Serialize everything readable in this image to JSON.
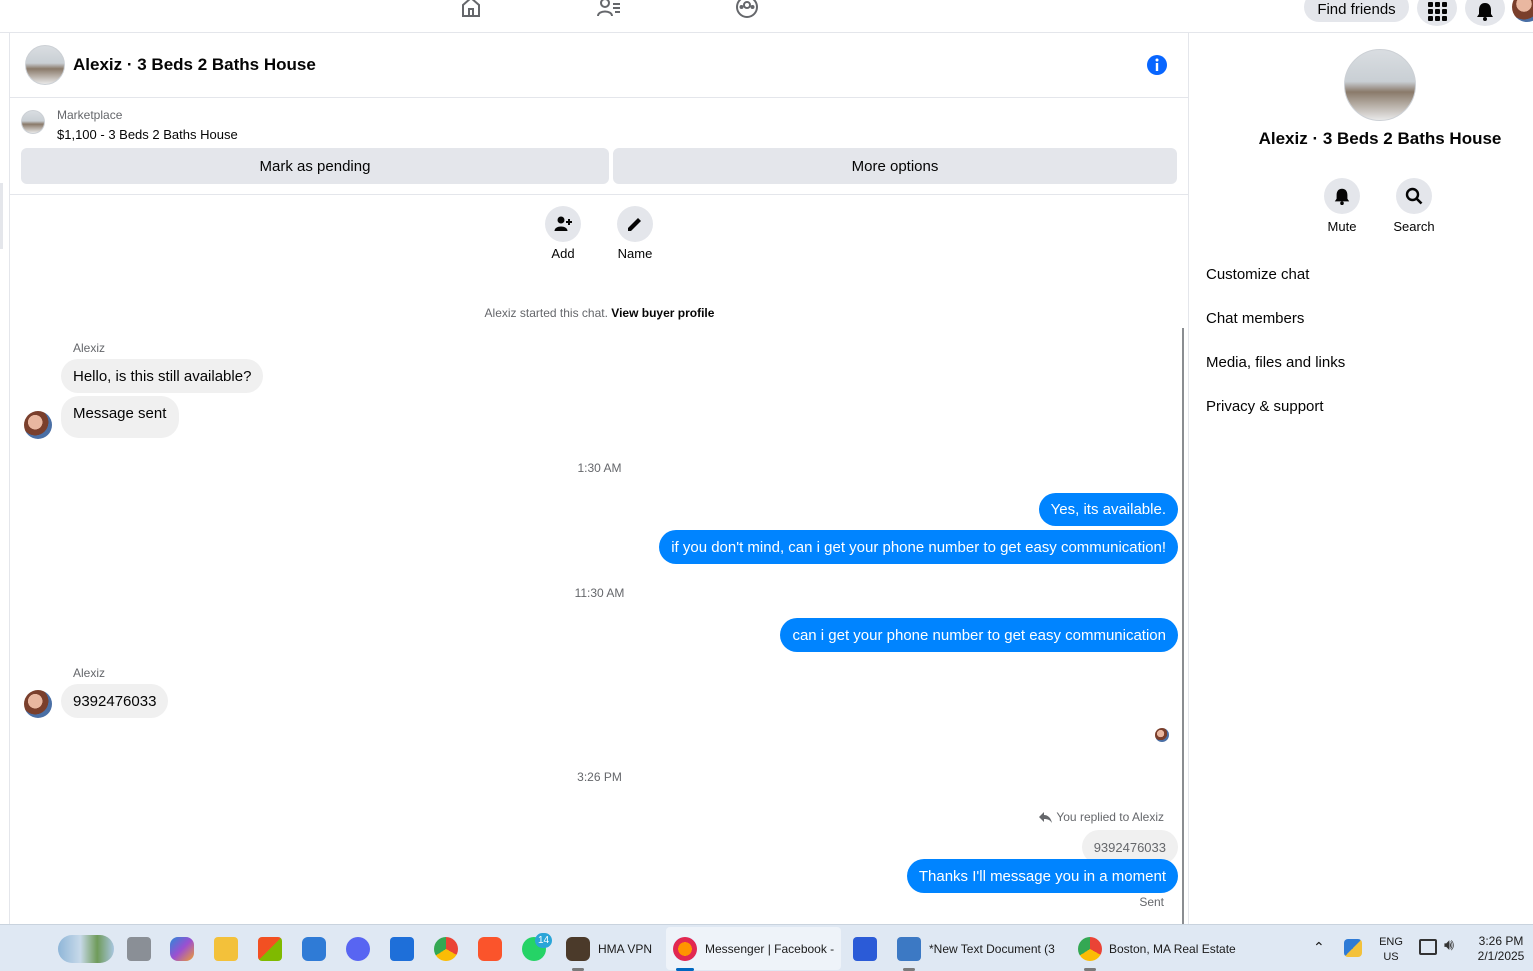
{
  "topnav": {
    "find_friends_label": "Find friends"
  },
  "chat": {
    "header_title": "Alexiz · 3 Beds 2 Baths House",
    "marketplace_label": "Marketplace",
    "listing_text": "$1,100 - 3 Beds 2 Baths House",
    "mark_pending_label": "Mark as pending",
    "more_options_label": "More options",
    "add_label": "Add",
    "name_label": "Name",
    "started_text": "Alexiz started this chat.",
    "view_profile_label": "View buyer profile",
    "messages": {
      "sender1": "Alexiz",
      "in1": "Hello, is this still available?",
      "in2": "Message sent",
      "time1": "1:30 AM",
      "out1": "Yes, its available.",
      "out2": "if you don't mind, can i get your phone number to get easy communication!",
      "time2": "11:30 AM",
      "out3": "can i get your phone number to get easy communication",
      "sender2": "Alexiz",
      "in3": "9392476033",
      "time3": "3:26 PM",
      "replied_label": "You replied to Alexiz",
      "quoted": "9392476033",
      "out4": "Thanks I'll message you in a moment",
      "status": "Sent"
    }
  },
  "right_panel": {
    "title": "Alexiz · 3 Beds 2 Baths House",
    "mute_label": "Mute",
    "search_label": "Search",
    "items": [
      "Customize chat",
      "Chat members",
      "Media, files and links",
      "Privacy & support"
    ]
  },
  "taskbar": {
    "whatsapp_badge": "14",
    "hma_label": "HMA VPN",
    "messenger_label": "Messenger | Facebook -",
    "notepad_label": "*New Text Document (3",
    "chrome_label": "Boston, MA Real Estate",
    "lang_top": "ENG",
    "lang_bottom": "US",
    "time": "3:26 PM",
    "date": "2/1/2025"
  },
  "colors": {
    "accent": "#0084ff",
    "bubble_in": "#f0f0f0",
    "button_bg": "#e4e6eb",
    "info": "#0866ff"
  }
}
